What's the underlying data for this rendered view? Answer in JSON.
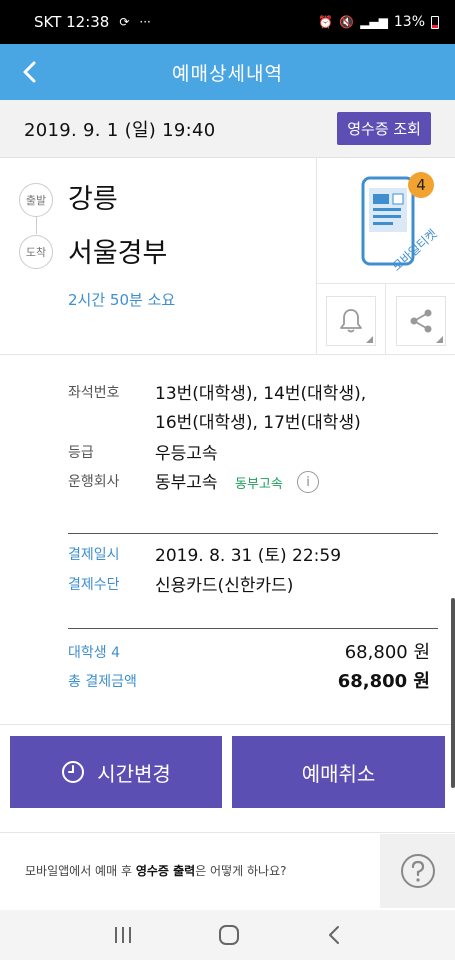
{
  "status_bar": {
    "carrier_time": "SKT 12:38",
    "battery": "13%"
  },
  "header": {
    "title": "예매상세내역"
  },
  "date_bar": {
    "datetime": "2019. 9. 1 (일) 19:40",
    "receipt_button": "영수증 조회"
  },
  "route": {
    "depart_badge": "출발",
    "arrive_badge": "도착",
    "departure": "강릉",
    "arrival": "서울경부",
    "duration": "2시간 50분 소요"
  },
  "mobile_ticket": {
    "count": "4",
    "label": "모바일티켓"
  },
  "details": {
    "seat_label": "좌석번호",
    "seat_line1": "13번(대학생), 14번(대학생),",
    "seat_line2": "16번(대학생), 17번(대학생)",
    "grade_label": "등급",
    "grade_value": "우등고속",
    "operator_label": "운행회사",
    "operator_value": "동부고속",
    "operator_tag": "동부고속"
  },
  "payment": {
    "date_label": "결제일시",
    "date_value": "2019. 8. 31 (토) 22:59",
    "method_label": "결제수단",
    "method_value": "신용카드(신한카드)"
  },
  "fare": {
    "item_label": "대학생 4",
    "item_amount": "68,800 원",
    "total_label": "총 결제금액",
    "total_amount": "68,800 원"
  },
  "actions": {
    "change_time": "시간변경",
    "cancel": "예매취소"
  },
  "faq": {
    "text_prefix": "모바일앱에서 예매 후 ",
    "text_bold": "영수증 출력",
    "text_suffix": "은 어떻게 하나요?"
  },
  "colors": {
    "header": "#4aa6e3",
    "accent_purple": "#5c4fb3",
    "link_blue": "#3f8fd0",
    "badge_orange": "#f2a22e"
  }
}
